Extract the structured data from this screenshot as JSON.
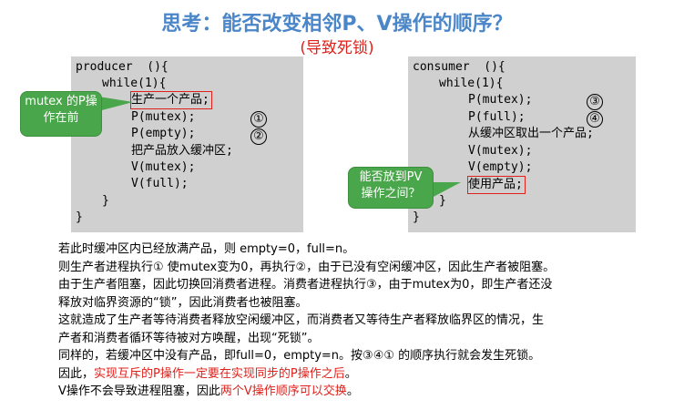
{
  "title": "思考：能否改变相邻P、V操作的顺序？",
  "subtitle": "(导致死锁)",
  "producer": {
    "lines": [
      "producer  (){",
      "while(1){",
      "生产一个产品;",
      "P(mutex);",
      "P(empty);",
      "把产品放入缓冲区;",
      "V(mutex);",
      "V(full);",
      "}",
      "}"
    ],
    "markers": [
      "①",
      "②"
    ],
    "callout": [
      "mutex 的P操",
      "作在前"
    ]
  },
  "consumer": {
    "lines": [
      "consumer  (){",
      "while(1){",
      "P(mutex);",
      "P(full);",
      "从缓冲区取出一个产品;",
      "V(mutex);",
      "V(empty);",
      "使用产品;",
      "}",
      "}"
    ],
    "markers": [
      "③",
      "④"
    ],
    "callout": [
      "能否放到PV",
      "操作之间？"
    ]
  },
  "explanation": {
    "p1": "若此时缓冲区内已经放满产品，则 empty=0，full=n。",
    "p2": "则生产者进程执行① 使mutex变为0，再执行②，由于已没有空闲缓冲区，因此生产者被阻塞。",
    "p3": "由于生产者阻塞，因此切换回消费者进程。消费者进程执行③，由于mutex为0，即生产者还没",
    "p4": "释放对临界资源的“锁”，因此消费者也被阻塞。",
    "p5": "这就造成了生产者等待消费者释放空闲缓冲区，而消费者又等待生产者释放临界区的情况，生",
    "p6": "产者和消费者循环等待被对方唤醒，出现“死锁”。",
    "p7": "同样的，若缓冲区中没有产品，即full=0，empty=n。按③④① 的顺序执行就会发生死锁。",
    "p8_a": "因此，",
    "p8_b": "实现互斥的P操作一定要在实现同步的P操作之后",
    "p8_c": "。",
    "p9_a": "V操作不会导致进程阻塞，因此",
    "p9_b": "两个V操作顺序可以交换",
    "p9_c": "。"
  },
  "colors": {
    "title": "#4a86c8",
    "red": "#e0201a",
    "callout": "#4aa64a",
    "codebox": "#d0d0d0"
  }
}
